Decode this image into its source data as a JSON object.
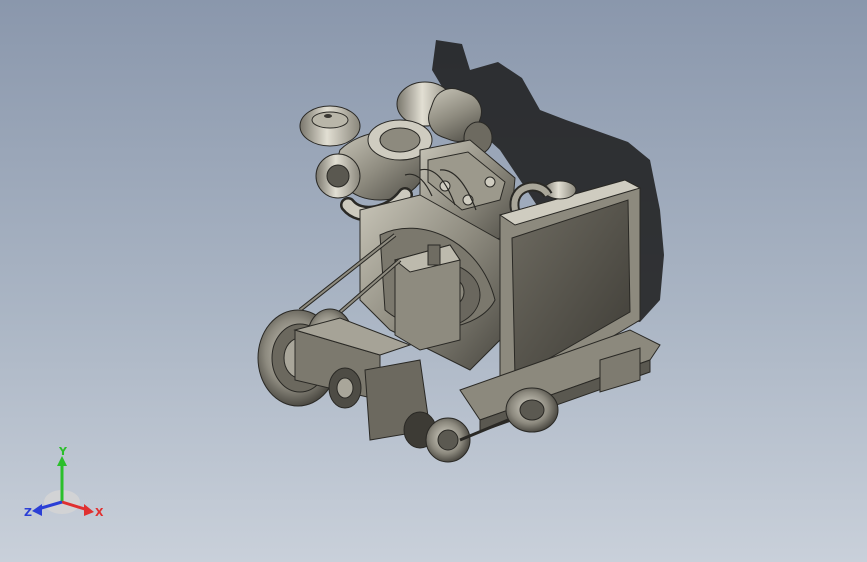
{
  "triad": {
    "y_label": "Y",
    "x_label": "X",
    "z_label": "Z",
    "y_color": "#2bbf2b",
    "x_color": "#e03030",
    "z_color": "#2b3fd6"
  },
  "colors": {
    "background_top": "#8a97ac",
    "background_bottom": "#c9d0da",
    "shadow": "#1b1b1b",
    "metal": "#8d8a7e"
  }
}
